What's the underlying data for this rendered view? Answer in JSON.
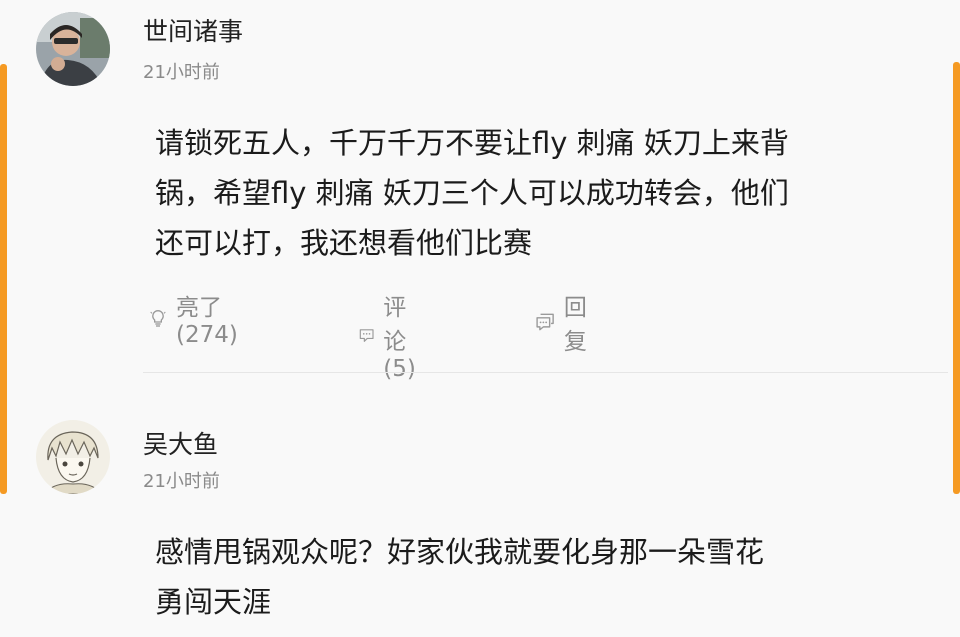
{
  "colors": {
    "accent": "#f59a23",
    "meta_text": "#8a8a8a",
    "body_text": "#1b1b1b"
  },
  "comments": [
    {
      "username": "世间诸事",
      "time": "21小时前",
      "text_lines": [
        "请锁死五人，千万千万不要让fly 刺痛 妖刀上来背",
        "锅，希望fly 刺痛 妖刀三个人可以成功转会，他们",
        "还可以打，我还想看他们比赛"
      ],
      "actions": {
        "like": {
          "icon": "lightbulb-icon",
          "label": "亮了(274)"
        },
        "comment": {
          "icon": "comment-bubble-icon",
          "label": "评论(5)"
        },
        "reply": {
          "icon": "reply-bubble-icon",
          "label": "回复"
        }
      }
    },
    {
      "username": "吴大鱼",
      "time": "21小时前",
      "text_lines": [
        "感情甩锅观众呢？好家伙我就要化身那一朵雪花",
        "勇闯天涯"
      ]
    }
  ]
}
